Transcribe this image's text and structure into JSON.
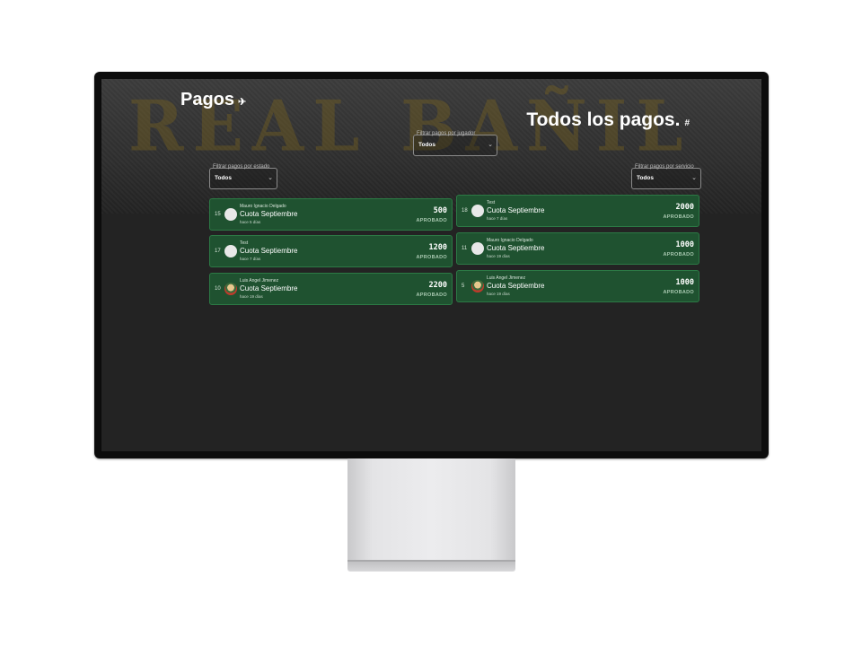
{
  "header": {
    "page_title": "Pagos",
    "page_title_icon": "pin-icon",
    "section_title": "Todos los pagos.",
    "section_title_icon": "hash-icon",
    "background_text": "REAL BAÑIL"
  },
  "filters": {
    "player": {
      "label": "Filtrar pagos por jugador",
      "value": "Todos"
    },
    "status": {
      "label": "Filtrar pagos por estado",
      "value": "Todos"
    },
    "service": {
      "label": "Filtrar pagos por servicio",
      "value": "Todos"
    }
  },
  "payments": [
    {
      "num": "15",
      "player": "Mauro Ignacio Delgado",
      "concept": "Cuota Septiembre",
      "ago": "hace 5 días",
      "amount": "500",
      "status": "APROBADO"
    },
    {
      "num": "18",
      "player": "Test",
      "concept": "Cuota Septiembre",
      "ago": "hace 7 días",
      "amount": "2000",
      "status": "APROBADO"
    },
    {
      "num": "17",
      "player": "Test",
      "concept": "Cuota Septiembre",
      "ago": "hace 7 días",
      "amount": "1200",
      "status": "APROBADO"
    },
    {
      "num": "11",
      "player": "Mauro Ignacio Delgado",
      "concept": "Cuota Septiembre",
      "ago": "hace 19 días",
      "amount": "1000",
      "status": "APROBADO"
    },
    {
      "num": "10",
      "player": "Luis Angel Jimenez",
      "concept": "Cuota Septiembre",
      "ago": "hace 19 días",
      "amount": "2200",
      "status": "APROBADO"
    },
    {
      "num": "5",
      "player": "Luis Angel Jimenez",
      "concept": "Cuota Septiembre",
      "ago": "hace 19 días",
      "amount": "1000",
      "status": "APROBADO"
    }
  ],
  "colors": {
    "card_bg": "#1f5230",
    "card_border": "#2c7a45",
    "screen_bg": "#232323"
  }
}
